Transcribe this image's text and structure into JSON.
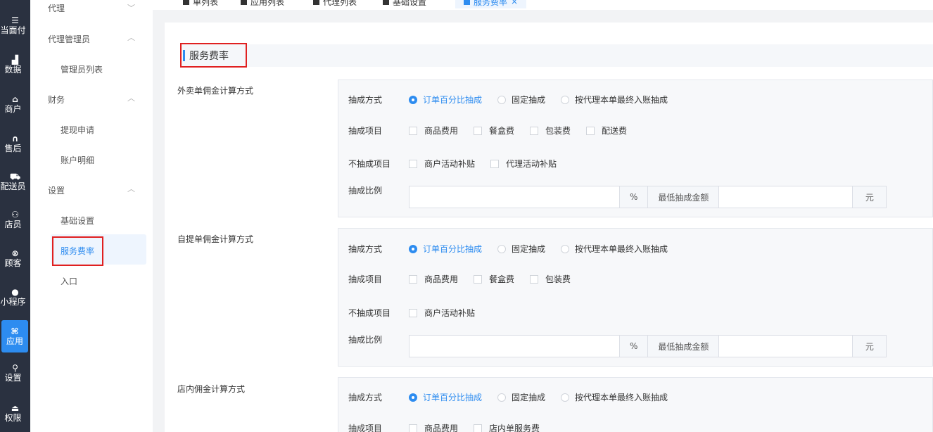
{
  "rail": {
    "items": [
      {
        "icon": "☰",
        "label": "当面付"
      },
      {
        "icon": "▟",
        "label": "数据"
      },
      {
        "icon": "⌂",
        "label": "商户"
      },
      {
        "icon": "∩",
        "label": "售后"
      },
      {
        "icon": "⛟",
        "label": "配送员"
      },
      {
        "icon": "⚇",
        "label": "店员"
      },
      {
        "icon": "⊗",
        "label": "顾客"
      },
      {
        "icon": "●",
        "label": "小程序"
      },
      {
        "icon": "⌘",
        "label": "应用"
      },
      {
        "icon": "⚲",
        "label": "设置"
      },
      {
        "icon": "⏏",
        "label": "权限"
      }
    ]
  },
  "subnav": {
    "agent": "代理",
    "agent_admin": "代理管理员",
    "admin_list": "管理员列表",
    "finance": "财务",
    "withdraw": "提现申请",
    "account_detail": "账户明细",
    "settings": "设置",
    "basic_settings": "基础设置",
    "service_rate": "服务费率",
    "entry": "入口"
  },
  "tabs": {
    "items": [
      "单列表",
      "应用列表",
      "代理列表",
      "基础设置",
      "服务费率"
    ],
    "close": "×"
  },
  "page": {
    "section_title": "服务费率"
  },
  "labels": {
    "method": "抽成方式",
    "items": "抽成项目",
    "excluded": "不抽成项目",
    "ratio": "抽成比例",
    "pct_order": "订单百分比抽成",
    "fixed": "固定抽成",
    "by_final": "按代理本单最终入账抽成",
    "goods_fee": "商品费用",
    "box_fee": "餐盒费",
    "pack_fee": "包装费",
    "delivery_fee": "配送费",
    "merchant_subsidy": "商户活动补贴",
    "agent_subsidy": "代理活动补贴",
    "percent": "%",
    "min_amount": "最低抽成金额",
    "yuan": "元",
    "instore_service_fee": "店内单服务费"
  },
  "blocks": {
    "takeout": "外卖单佣金计算方式",
    "pickup": "自提单佣金计算方式",
    "instore": "店内佣金计算方式"
  },
  "colors": {
    "accent": "#2d8cf0",
    "rail_bg": "#2a3140",
    "highlight_box": "#e02020"
  }
}
